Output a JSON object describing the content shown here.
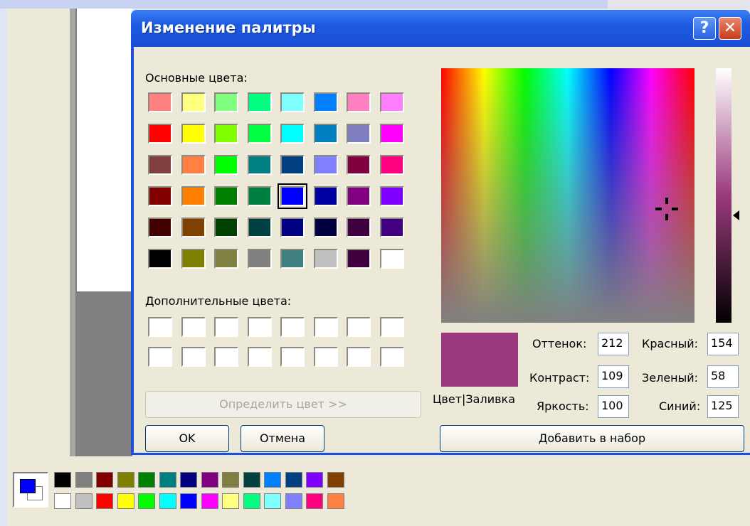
{
  "dialog": {
    "title": "Изменение палитры",
    "help_label": "?",
    "close_label": "✕",
    "basic_colors_label": "Основные цвета:",
    "custom_colors_label": "Дополнительные цвета:",
    "define_button": "Определить цвет >>",
    "ok_button": "OK",
    "cancel_button": "Отмена",
    "add_button": "Добавить в набор",
    "preview_label": "Цвет|Заливка",
    "preview_color": "#9a3a7d",
    "selected_basic_index": 28,
    "basic_colors": [
      "#ff8080",
      "#ffff80",
      "#80ff80",
      "#00ff80",
      "#80ffff",
      "#0080ff",
      "#ff80c0",
      "#ff80ff",
      "#ff0000",
      "#ffff00",
      "#80ff00",
      "#00ff40",
      "#00ffff",
      "#0080c0",
      "#8080c0",
      "#ff00ff",
      "#804040",
      "#ff8040",
      "#00ff00",
      "#008080",
      "#004080",
      "#8080ff",
      "#800040",
      "#ff0080",
      "#800000",
      "#ff8000",
      "#008000",
      "#008040",
      "#0000ff",
      "#0000a0",
      "#800080",
      "#8000ff",
      "#400000",
      "#804000",
      "#004000",
      "#004040",
      "#000080",
      "#000040",
      "#400040",
      "#400080",
      "#000000",
      "#808000",
      "#808040",
      "#808080",
      "#408080",
      "#c0c0c0",
      "#400040",
      "#ffffff"
    ],
    "custom_colors": [
      "#ffffff",
      "#ffffff",
      "#ffffff",
      "#ffffff",
      "#ffffff",
      "#ffffff",
      "#ffffff",
      "#ffffff",
      "#ffffff",
      "#ffffff",
      "#ffffff",
      "#ffffff",
      "#ffffff",
      "#ffffff",
      "#ffffff",
      "#ffffff"
    ],
    "fields": {
      "hue": {
        "label": "Оттенок:",
        "value": "212"
      },
      "sat": {
        "label": "Контраст:",
        "value": "109"
      },
      "lum": {
        "label": "Яркость:",
        "value": "100"
      },
      "red": {
        "label": "Красный:",
        "value": "154"
      },
      "green": {
        "label": "Зеленый:",
        "value": "58"
      },
      "blue": {
        "label": "Синий:",
        "value": "125"
      }
    }
  },
  "palette_bar": {
    "foreground": "#0000ff",
    "background": "#ffffff",
    "colors": [
      "#000000",
      "#808080",
      "#800000",
      "#808000",
      "#008000",
      "#008080",
      "#000080",
      "#800080",
      "#808040",
      "#004040",
      "#0080ff",
      "#004080",
      "#8000ff",
      "#804000",
      "#ffffff",
      "#c0c0c0",
      "#ff0000",
      "#ffff00",
      "#00ff00",
      "#00ffff",
      "#0000ff",
      "#ff00ff",
      "#ffff80",
      "#00ff80",
      "#80ffff",
      "#8080ff",
      "#ff0080",
      "#ff8040"
    ]
  }
}
